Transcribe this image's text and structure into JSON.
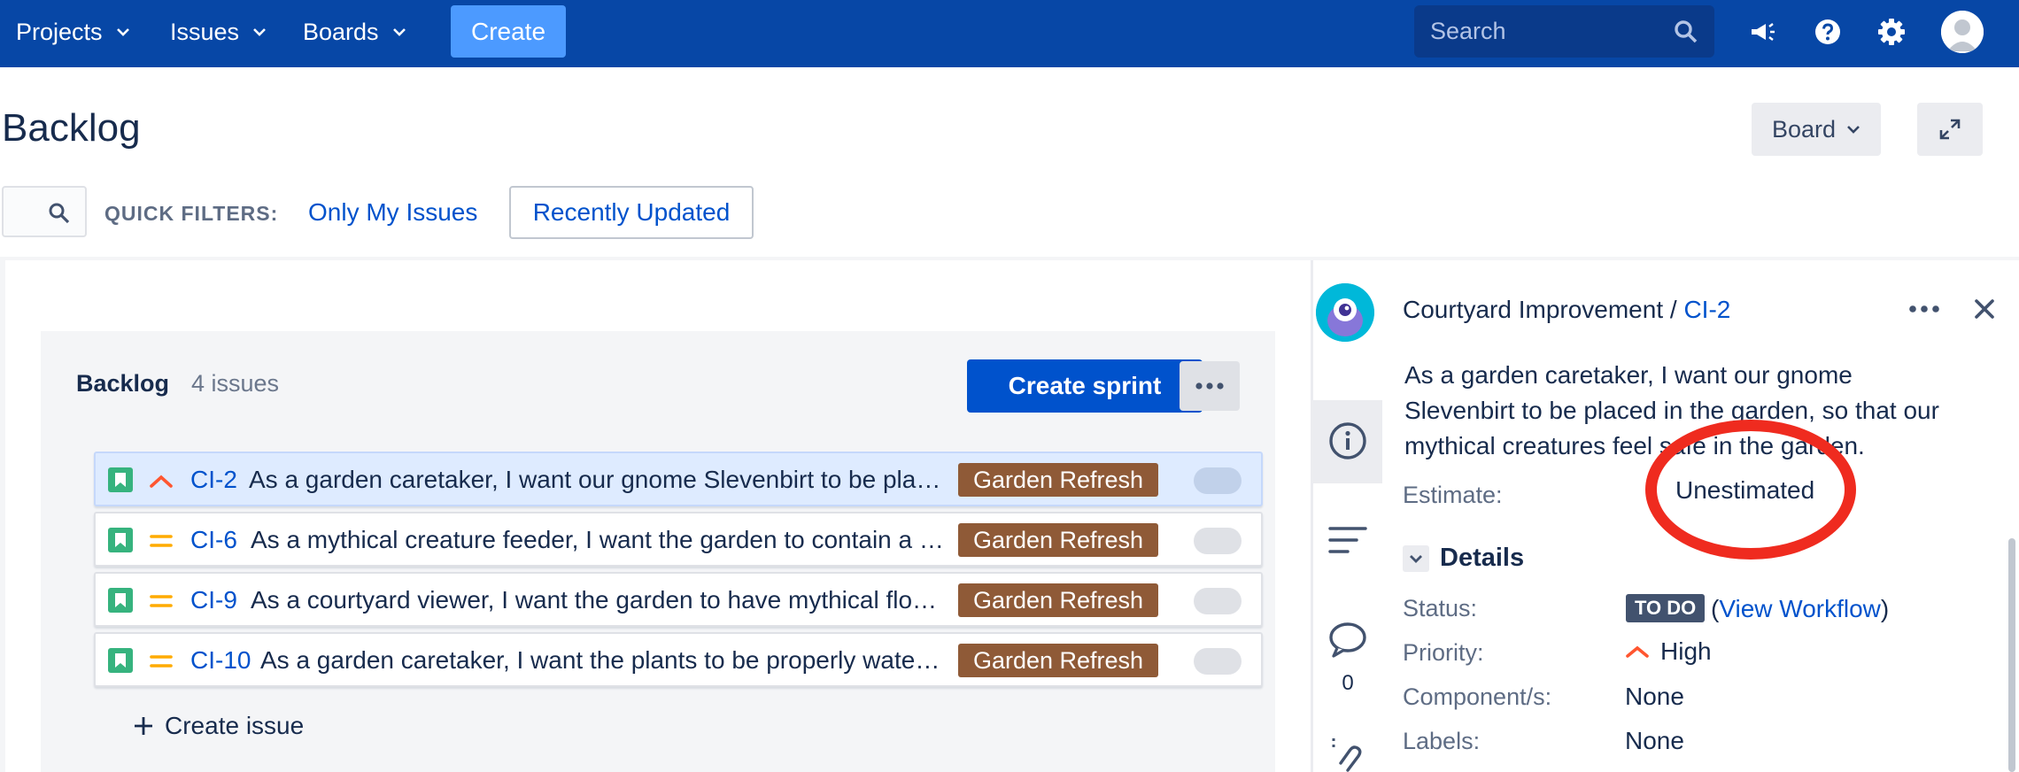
{
  "nav": {
    "projects": "Projects",
    "issues": "Issues",
    "boards": "Boards",
    "create": "Create",
    "search_placeholder": "Search"
  },
  "header": {
    "title": "Backlog",
    "board_button": "Board"
  },
  "filters": {
    "label": "QUICK FILTERS:",
    "only_my_issues": "Only My Issues",
    "recently_updated": "Recently Updated"
  },
  "backlog": {
    "title": "Backlog",
    "count": "4 issues",
    "create_sprint": "Create sprint",
    "create_issue": "Create issue",
    "issues": [
      {
        "key": "CI-2",
        "summary": "As a garden caretaker, I want our gnome Slevenbirt to be placed in the garden, so that our mythical creatures feel safe in the garden.",
        "epic": "Garden Refresh",
        "priority": "high",
        "selected": true
      },
      {
        "key": "CI-6",
        "summary": "As a mythical creature feeder, I want the garden to contain a feeding station for our creatures.",
        "epic": "Garden Refresh",
        "priority": "medium",
        "selected": false
      },
      {
        "key": "CI-9",
        "summary": "As a courtyard viewer, I want the garden to have mythical flowers to look at.",
        "epic": "Garden Refresh",
        "priority": "medium",
        "selected": false
      },
      {
        "key": "CI-10",
        "summary": "As a garden caretaker, I want the plants to be properly watered.",
        "epic": "Garden Refresh",
        "priority": "medium",
        "selected": false
      }
    ]
  },
  "sidebar": {
    "comment_count": "0"
  },
  "detail": {
    "project": "Courtyard Improvement",
    "separator": " / ",
    "issue_key": "CI-2",
    "description": "As a garden caretaker, I want our gnome Slevenbirt to be placed in the garden, so that our mythical creatures feel safe in the garden.",
    "estimate_label": "Estimate:",
    "estimate_value": "Unestimated",
    "details_heading": "Details",
    "status_label": "Status:",
    "status_value": "TO DO",
    "workflow_open": " (",
    "workflow_link": "View Workflow",
    "workflow_close": ")",
    "priority_label": "Priority:",
    "priority_value": "High",
    "components_label": "Component/s:",
    "components_value": "None",
    "labels_label": "Labels:",
    "labels_value": "None"
  },
  "colors": {
    "nav_bg": "#0747a6",
    "accent": "#0052cc",
    "epic": "#8f5a37",
    "story": "#36b37e",
    "priority_high": "#ff5630",
    "priority_medium": "#ffab00",
    "annotation": "#ef2b1f"
  }
}
